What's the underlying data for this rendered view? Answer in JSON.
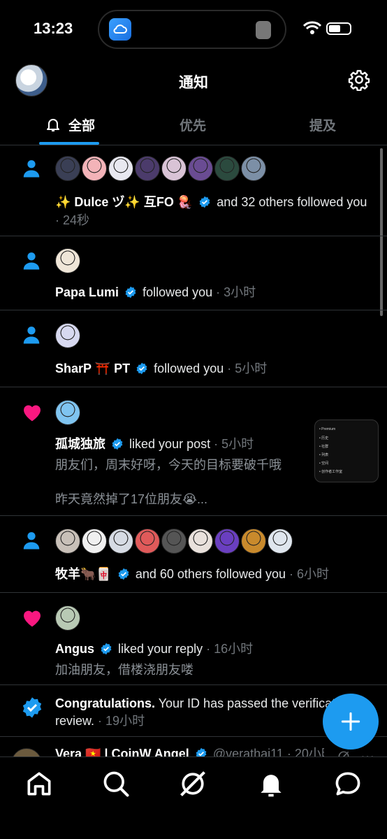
{
  "status": {
    "time": "13:23"
  },
  "header": {
    "title": "通知"
  },
  "tabs": [
    {
      "label": "全部",
      "active": true
    },
    {
      "label": "优先",
      "active": false
    },
    {
      "label": "提及",
      "active": false
    }
  ],
  "notifications": [
    {
      "kind": "follow",
      "name": "✨ Dulce ヅ✨  互FO 🪼",
      "verified": true,
      "text": "and 32 others followed you",
      "time": "· 24秒",
      "avatar_colors": [
        "#3a3f55",
        "#f3b3b8",
        "#e8e8f0",
        "#4b3b6b",
        "#d9c3d6",
        "#6a4c93",
        "#2b4a3e",
        "#7c8fa6"
      ]
    },
    {
      "kind": "follow",
      "name": "Papa Lumi",
      "verified": true,
      "text": "followed you",
      "time": "· 3小时",
      "avatar_colors": [
        "#efe6d8"
      ]
    },
    {
      "kind": "follow",
      "name": "SharP ⛩️ PT",
      "verified": true,
      "text": "followed you",
      "time": "· 5小时",
      "avatar_colors": [
        "#d7d9f0"
      ]
    },
    {
      "kind": "like",
      "name": "孤城独旅",
      "verified": true,
      "text": "liked your post",
      "time": "· 5小时",
      "line2": "朋友们，周末好呀，今天的目标要破千哦",
      "line3": "昨天竟然掉了17位朋友😭...",
      "avatar_colors": [
        "#7fc4f0"
      ]
    },
    {
      "kind": "follow",
      "name": "牧羊🐂🀄",
      "verified": true,
      "text": "and 60 others followed you",
      "time": "· 6小时",
      "avatar_colors": [
        "#c8c0b8",
        "#f0f0f0",
        "#d6dbe4",
        "#e05a5a",
        "#555",
        "#e9e1dc",
        "#6a3fc0",
        "#c98a2c",
        "#dfe6ee"
      ]
    },
    {
      "kind": "like",
      "name": "Angus",
      "verified": true,
      "text": "liked your reply",
      "time": "· 16小时",
      "line2": "加油朋友，借楼浇朋友喽",
      "avatar_colors": [
        "#b8c9b4"
      ]
    },
    {
      "kind": "system",
      "name": "Congratulations.",
      "text": "Your ID has passed the verification",
      "line2": "review.",
      "time": "· 19小时"
    },
    {
      "kind": "mention",
      "name": "Vera 🇻🇳 | CoinW Angel",
      "verified": true,
      "text": "@verathai11",
      "time": "· 20小时"
    }
  ],
  "preview_thumb_items": [
    "Premium",
    "历史",
    "社群",
    "列表",
    "空间",
    "创作者工作室"
  ],
  "colors": {
    "accent": "#1d9bf0",
    "like": "#f91880",
    "muted": "#71767b"
  },
  "bottom_nav": [
    "home-icon",
    "search-icon",
    "grok-icon",
    "notifications-icon",
    "messages-icon"
  ]
}
